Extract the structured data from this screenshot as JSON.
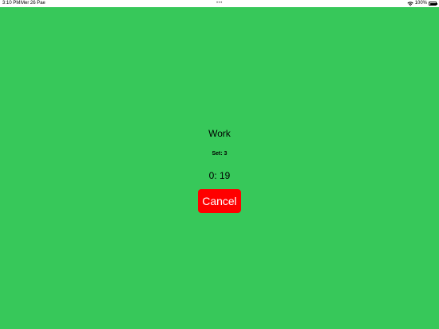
{
  "status_bar": {
    "time": "3:10 PM",
    "date": "Mer 26 Pae",
    "dots": "•••",
    "battery_percent": "100%",
    "icons": [
      "wifi-icon",
      "battery-icon"
    ]
  },
  "workout": {
    "phase": "Work",
    "set_label": "Set: 3",
    "timer": "0: 19",
    "cancel_label": "Cancel"
  },
  "colors": {
    "background": "#37c85a",
    "cancel_button": "#ff0000",
    "cancel_text": "#ffffff"
  }
}
